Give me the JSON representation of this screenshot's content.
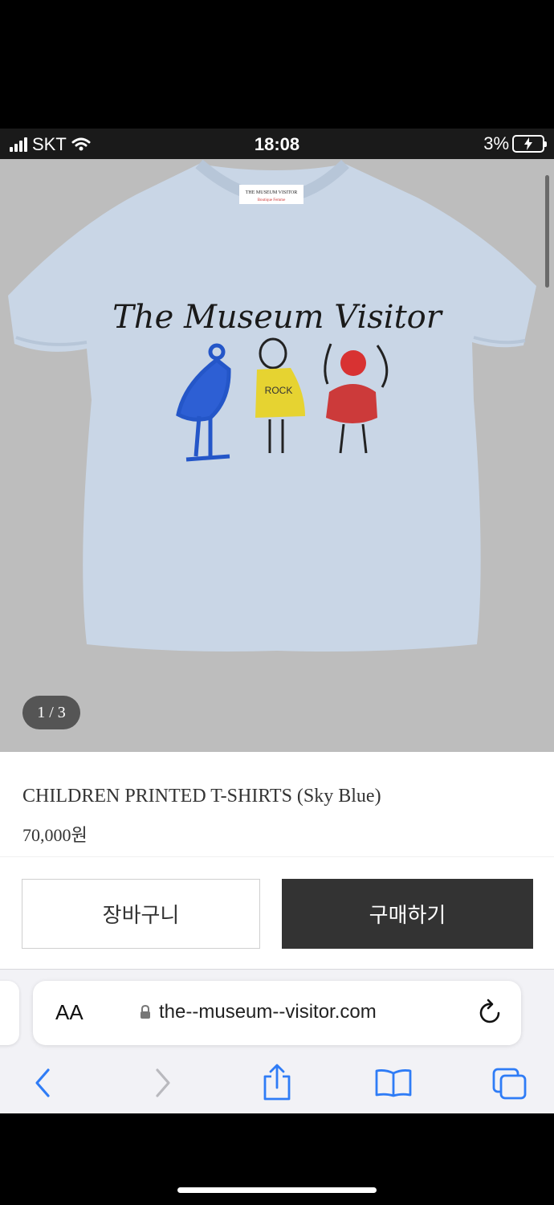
{
  "status_bar": {
    "carrier": "SKT",
    "time": "18:08",
    "battery": "3%"
  },
  "gallery": {
    "tshirt_label_line1": "THE MUSEUM VISITOR",
    "tshirt_label_line2": "Boutique Femme",
    "print_text": "The Museum Visitor",
    "figure_text": "ROCK",
    "pager": "1 / 3",
    "shirt_color": "#c9d6e6",
    "background_color": "#bdbdbd"
  },
  "product": {
    "name": "CHILDREN PRINTED T-SHIRTS (Sky Blue)",
    "price": "70,000원"
  },
  "actions": {
    "cart_label": "장바구니",
    "buy_label": "구매하기",
    "buy_color": "#333333"
  },
  "browser": {
    "aa_label": "AA",
    "url": "the--museum--visitor.com",
    "accent_color": "#2f7cf6",
    "toolbar_icons": [
      "back-icon",
      "forward-icon",
      "share-icon",
      "bookmarks-icon",
      "tabs-icon"
    ]
  }
}
